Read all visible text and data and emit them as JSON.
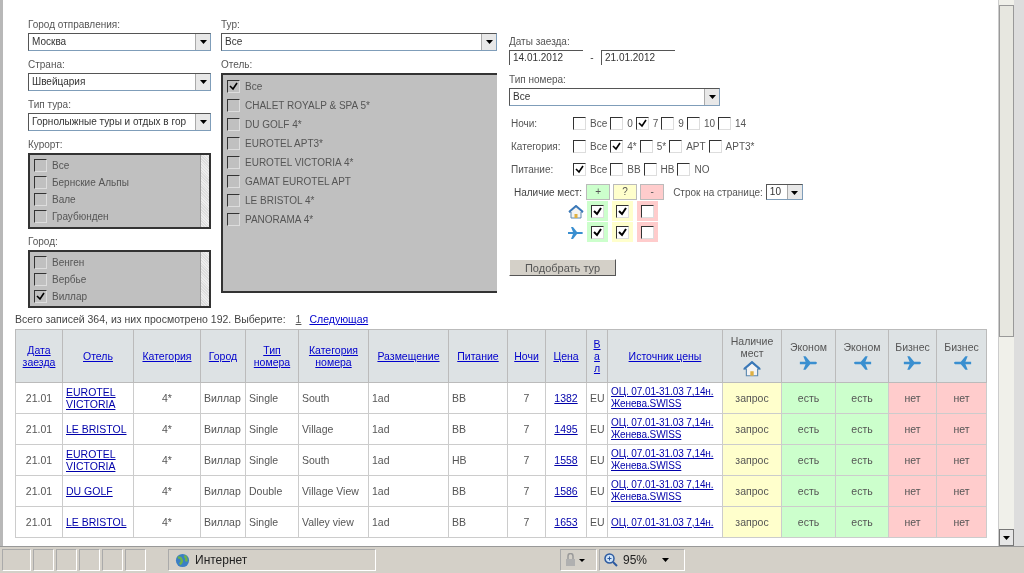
{
  "form": {
    "departure_city": {
      "label": "Город отправления:",
      "value": "Москва"
    },
    "country": {
      "label": "Страна:",
      "value": "Швейцария"
    },
    "tour_type": {
      "label": "Тип тура:",
      "value": "Горнолыжные туры и отдых в гор"
    },
    "resort": {
      "label": "Курорт:",
      "items": [
        {
          "label": "Все",
          "checked": false
        },
        {
          "label": "Бернские Альпы",
          "checked": false
        },
        {
          "label": "Вале",
          "checked": false
        },
        {
          "label": "Граубюнден",
          "checked": false
        }
      ]
    },
    "city": {
      "label": "Город:",
      "items": [
        {
          "label": "Венген",
          "checked": false
        },
        {
          "label": "Вербье",
          "checked": false
        },
        {
          "label": "Виллар",
          "checked": true
        }
      ]
    },
    "tour": {
      "label": "Тур:",
      "value": "Все"
    },
    "hotel": {
      "label": "Отель:",
      "items": [
        {
          "label": "Все",
          "checked": true
        },
        {
          "label": "CHALET ROYALP & SPA 5*",
          "checked": false
        },
        {
          "label": "DU GOLF 4*",
          "checked": false
        },
        {
          "label": "EUROTEL APT3*",
          "checked": false
        },
        {
          "label": "EUROTEL VICTORIA 4*",
          "checked": false
        },
        {
          "label": "GAMAT EUROTEL APT",
          "checked": false
        },
        {
          "label": "LE BRISTOL 4*",
          "checked": false
        },
        {
          "label": "PANORAMA 4*",
          "checked": false
        }
      ]
    },
    "dates": {
      "label": "Даты заезда:",
      "from": "14.01.2012",
      "separator": "-",
      "to": "21.01.2012"
    },
    "room_type": {
      "label": "Тип номера:",
      "value": "Все"
    },
    "filters": [
      {
        "label": "Ночи:",
        "options": [
          {
            "label": "Все",
            "checked": false
          },
          {
            "label": "0",
            "checked": false
          },
          {
            "label": "7",
            "checked": true
          },
          {
            "label": "9",
            "checked": false
          },
          {
            "label": "10",
            "checked": false
          },
          {
            "label": "14",
            "checked": false
          }
        ]
      },
      {
        "label": "Категория:",
        "options": [
          {
            "label": "Все",
            "checked": false
          },
          {
            "label": "4*",
            "checked": true
          },
          {
            "label": "5*",
            "checked": false
          },
          {
            "label": "APT",
            "checked": false
          },
          {
            "label": "APT3*",
            "checked": false
          }
        ]
      },
      {
        "label": "Питание:",
        "options": [
          {
            "label": "Все",
            "checked": true
          },
          {
            "label": "BB",
            "checked": false
          },
          {
            "label": "HB",
            "checked": false
          },
          {
            "label": "NO",
            "checked": false
          }
        ]
      }
    ],
    "availability": {
      "label": "Наличие мест:",
      "legend": [
        {
          "label": "+",
          "color": "#ccffcc"
        },
        {
          "label": "?",
          "color": "#ffffcc"
        },
        {
          "label": "-",
          "color": "#ffcccc"
        }
      ],
      "rows": [
        {
          "kind": "house",
          "checks": [
            {
              "checked": true
            },
            {
              "checked": true
            },
            {
              "checked": false
            }
          ]
        },
        {
          "kind": "plane",
          "checks": [
            {
              "checked": true
            },
            {
              "checked": true
            },
            {
              "checked": false
            }
          ]
        }
      ]
    },
    "rows_per_page": {
      "label": "Строк на странице:",
      "value": "10"
    },
    "submit": "Подобрать тур"
  },
  "summary": {
    "text": "Всего записей 364, из них просмотрено 192. Выберите:",
    "pages": [
      {
        "label": "1",
        "selected": true
      },
      {
        "label": "Следующая",
        "selected": false
      }
    ]
  },
  "table": {
    "columns": [
      {
        "label": "Дата заезда",
        "kind": "link"
      },
      {
        "label": "Отель",
        "kind": "link"
      },
      {
        "label": "Категория",
        "kind": "link"
      },
      {
        "label": "Город",
        "kind": "link"
      },
      {
        "label": "Тип номера",
        "kind": "link"
      },
      {
        "label": "Категория номера",
        "kind": "link"
      },
      {
        "label": "Размещение",
        "kind": "link"
      },
      {
        "label": "Питание",
        "kind": "link"
      },
      {
        "label": "Ночи",
        "kind": "link"
      },
      {
        "label": "Цена",
        "kind": "link"
      },
      {
        "label": "Вал",
        "kind": "vertical"
      },
      {
        "label": "Источник цены",
        "kind": "link"
      },
      {
        "label": "Наличие мест",
        "kind": "house"
      },
      {
        "label": "Эконом",
        "kind": "plane-right"
      },
      {
        "label": "Эконом",
        "kind": "plane-left"
      },
      {
        "label": "Бизнес",
        "kind": "plane-right"
      },
      {
        "label": "Бизнес",
        "kind": "plane-left"
      }
    ],
    "rows": [
      {
        "date": "21.01",
        "hotel": "EUROTEL VICTORIA",
        "category": "4*",
        "city": "Виллар",
        "room_type": "Single",
        "room_category": "South",
        "accommodation": "1ad",
        "meal": "BB",
        "nights": "7",
        "price": "1382",
        "currency": "EU",
        "source": [
          "ОЦ. 07.01-31.03 7,14н.",
          "Женева.SWISS"
        ],
        "availability": [
          {
            "text": "запрос",
            "kind": "request"
          },
          {
            "text": "есть",
            "kind": "yes"
          },
          {
            "text": "есть",
            "kind": "yes"
          },
          {
            "text": "нет",
            "kind": "no"
          },
          {
            "text": "нет",
            "kind": "no"
          }
        ]
      },
      {
        "date": "21.01",
        "hotel": "LE BRISTOL",
        "category": "4*",
        "city": "Виллар",
        "room_type": "Single",
        "room_category": "Village",
        "accommodation": "1ad",
        "meal": "BB",
        "nights": "7",
        "price": "1495",
        "currency": "EU",
        "source": [
          "ОЦ. 07.01-31.03 7,14н.",
          "Женева.SWISS"
        ],
        "availability": [
          {
            "text": "запрос",
            "kind": "request"
          },
          {
            "text": "есть",
            "kind": "yes"
          },
          {
            "text": "есть",
            "kind": "yes"
          },
          {
            "text": "нет",
            "kind": "no"
          },
          {
            "text": "нет",
            "kind": "no"
          }
        ]
      },
      {
        "date": "21.01",
        "hotel": "EUROTEL VICTORIA",
        "category": "4*",
        "city": "Виллар",
        "room_type": "Single",
        "room_category": "South",
        "accommodation": "1ad",
        "meal": "HB",
        "nights": "7",
        "price": "1558",
        "currency": "EU",
        "source": [
          "ОЦ. 07.01-31.03 7,14н.",
          "Женева.SWISS"
        ],
        "availability": [
          {
            "text": "запрос",
            "kind": "request"
          },
          {
            "text": "есть",
            "kind": "yes"
          },
          {
            "text": "есть",
            "kind": "yes"
          },
          {
            "text": "нет",
            "kind": "no"
          },
          {
            "text": "нет",
            "kind": "no"
          }
        ]
      },
      {
        "date": "21.01",
        "hotel": "DU GOLF",
        "category": "4*",
        "city": "Виллар",
        "room_type": "Double",
        "room_category": "Village View",
        "accommodation": "1ad",
        "meal": "BB",
        "nights": "7",
        "price": "1586",
        "currency": "EU",
        "source": [
          "ОЦ. 07.01-31.03 7,14н.",
          "Женева.SWISS"
        ],
        "availability": [
          {
            "text": "запрос",
            "kind": "request"
          },
          {
            "text": "есть",
            "kind": "yes"
          },
          {
            "text": "есть",
            "kind": "yes"
          },
          {
            "text": "нет",
            "kind": "no"
          },
          {
            "text": "нет",
            "kind": "no"
          }
        ]
      },
      {
        "date": "21.01",
        "hotel": "LE BRISTOL",
        "category": "4*",
        "city": "Виллар",
        "room_type": "Single",
        "room_category": "Valley view",
        "accommodation": "1ad",
        "meal": "BB",
        "nights": "7",
        "price": "1653",
        "currency": "EU",
        "source": [
          "ОЦ. 07.01-31.03 7,14н."
        ],
        "availability": [
          {
            "text": "запрос",
            "kind": "request"
          },
          {
            "text": "есть",
            "kind": "yes"
          },
          {
            "text": "есть",
            "kind": "yes"
          },
          {
            "text": "нет",
            "kind": "no"
          },
          {
            "text": "нет",
            "kind": "no"
          }
        ]
      }
    ]
  },
  "status_bar": {
    "zone": "Интернет",
    "zoom": "95%"
  }
}
